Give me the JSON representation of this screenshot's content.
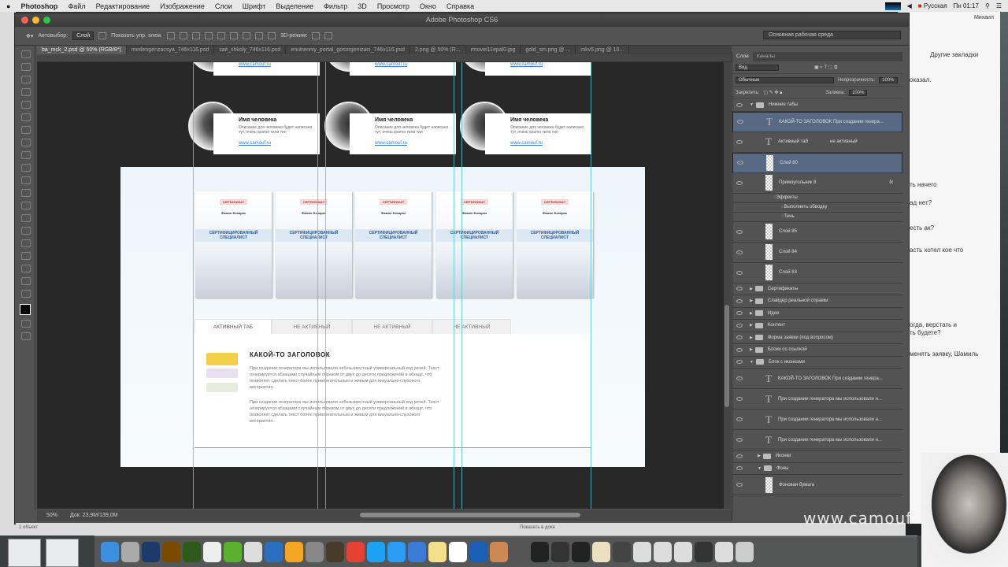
{
  "menubar": {
    "app": "Photoshop",
    "items": [
      "Файл",
      "Редактирование",
      "Изображение",
      "Слои",
      "Шрифт",
      "Выделение",
      "Фильтр",
      "3D",
      "Просмотр",
      "Окно",
      "Справка"
    ],
    "language": "Русская",
    "clock": "Пн 01:17"
  },
  "window": {
    "title": "Adobe Photoshop CS6"
  },
  "options": {
    "autoselect_label": "Автовыбор:",
    "autoselect_value": "Слой",
    "show_controls": "Показать упр. элем.",
    "mode_3d": "3D-режим:",
    "workspace": "Основная рабочая среда"
  },
  "doc_tabs": [
    "ba_mck_2.psd @ 50% (RGB/8*)",
    "medengenzacsya_746x116.psd",
    "sait_shkoly_746x116.psd",
    "enutrenniy_portal_gosorgenizaci_746x116.psd",
    "2.png @ 50% (R...",
    "rmovei11epal0.jpg",
    "gold_sm.png @ ...",
    "mkv5.png @ 10..."
  ],
  "status": {
    "zoom": "50%",
    "doc": "Док: 23,9М/139,0М"
  },
  "canvas": {
    "person_cards": {
      "name": "Имя человека",
      "desc": "Описание для человека будет написано тут, очень кратко тили тил",
      "link": "www.camouf.ru"
    },
    "certificate": {
      "title": "СЕРТИФИКАТ",
      "name": "Фамил Бохарах",
      "subtitle": "СЕРТИФИЦИРОВАННЫЙ СПЕЦИАЛИСТ"
    },
    "tabs": [
      "АКТИВНЫЙ ТАБ",
      "НЕ АКТИВНЫЙ",
      "НЕ АКТИВНЫЙ",
      "НЕ АКТИВНЫЙ"
    ],
    "heading": "КАКОЙ-ТО ЗАГОЛОВОК",
    "paragraph1": "При создании генератора мы использовали небезызвестный универсальный код речей. Текст генерируется абзацами случайным образом от двух до десяти предложений в абзаце, что позволяет сделать текст более привлекательным и живым для визуально-слухового восприятия.",
    "paragraph2": "При создании генератора мы использовали небезызвестный универсальный код речей. Текст генерируется абзацами случайным образом от двух до десяти предложений в абзаце, что позволяет сделать текст более привлекательным и живым для визуально-слухового восприятия."
  },
  "layers_panel": {
    "tabs": [
      "Слои",
      "Каналы"
    ],
    "filter": "Вид",
    "blend": "Обычные",
    "opacity_label": "Непрозрачность:",
    "opacity": "100%",
    "lock_label": "Закрепить:",
    "fill_label": "Заливка:",
    "fill": "100%",
    "layers": [
      {
        "type": "group",
        "name": "Нижние табы",
        "open": true,
        "indent": 0
      },
      {
        "type": "text",
        "name": "КАКОЙ-ТО ЗАГОЛОВОК  При создании генера...",
        "selected": true
      },
      {
        "type": "text",
        "name": "Активный таб",
        "extra": "не активный"
      },
      {
        "type": "pixel",
        "name": "Слой 80",
        "selected": true
      },
      {
        "type": "pixel",
        "name": "Прямоугольник 8",
        "fx": true
      },
      {
        "type": "effects",
        "name": "Эффекты"
      },
      {
        "type": "effect",
        "name": "Выполнить обводку"
      },
      {
        "type": "effect",
        "name": "Тень"
      },
      {
        "type": "pixel",
        "name": "Слой 85"
      },
      {
        "type": "pixel",
        "name": "Слой 84"
      },
      {
        "type": "pixel",
        "name": "Слой 83"
      },
      {
        "type": "group",
        "name": "Сертификаты"
      },
      {
        "type": "group",
        "name": "Слайдер реальной справки"
      },
      {
        "type": "group",
        "name": "Идеи"
      },
      {
        "type": "group",
        "name": "Контент"
      },
      {
        "type": "group",
        "name": "Форма заявки (под вопросом)"
      },
      {
        "type": "group",
        "name": "Блоки со ссылкой"
      },
      {
        "type": "group",
        "name": "Блок с иконками",
        "open": true
      },
      {
        "type": "text",
        "name": "КАКОЙ-ТО ЗАГОЛОВОК  При создании генера..."
      },
      {
        "type": "text",
        "name": "При создании генератора мы использовали н..."
      },
      {
        "type": "text",
        "name": "При создании генератора мы использовали н..."
      },
      {
        "type": "text",
        "name": "При создании генератора мы использовали н..."
      },
      {
        "type": "group",
        "name": "Иконки",
        "indent": 1
      },
      {
        "type": "group",
        "name": "Фоны",
        "indent": 1,
        "open": true
      },
      {
        "type": "pixel",
        "name": "Фоновая бумага"
      }
    ]
  },
  "browser": {
    "bookmarks": "Другие закладки",
    "user": "Михаил",
    "lines": [
      "оказал.",
      "ть начего",
      "ад нет?",
      "есть ак?",
      "асть хотел кое что",
      "огда, верстать и",
      "ть будете?",
      "менять заявку, Шамиль"
    ]
  },
  "desktop": {
    "footer_left": "1 объект",
    "footer_mid": "Показать в доке"
  },
  "watermark": "www.camouf",
  "colors": {
    "guide": "#4fc6d8",
    "selected_layer": "#586a83",
    "ps_bg": "#535353",
    "canvas_bg": "#282828"
  }
}
